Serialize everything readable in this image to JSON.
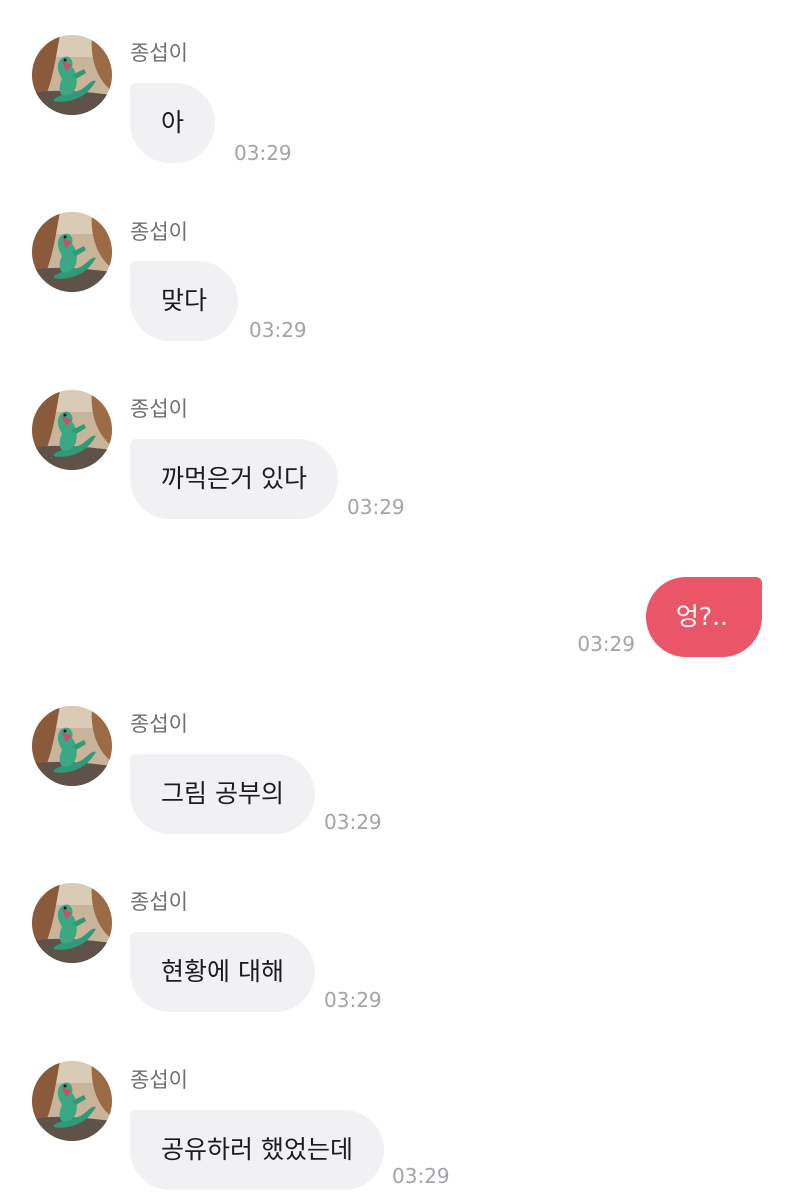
{
  "conversation": {
    "sender_name": "종섭이",
    "messages": [
      {
        "text": "아",
        "time": "03:29"
      },
      {
        "text": "맞다",
        "time": "03:29"
      },
      {
        "text": "까먹은거 있다",
        "time": "03:29"
      },
      {
        "text": "엉?..",
        "time": "03:29"
      },
      {
        "text": "그림 공부의",
        "time": "03:29"
      },
      {
        "text": "현황에 대해",
        "time": "03:29"
      },
      {
        "text": "공유하러 했었는데",
        "time": "03:29"
      }
    ]
  },
  "colors": {
    "incoming_bubble": "#f1f1f4",
    "outgoing_bubble": "#ea5567",
    "timestamp": "#a3a3a8",
    "sender_name": "#6e6e73"
  },
  "icons": {
    "avatar": "dinosaur-figure-avatar"
  }
}
